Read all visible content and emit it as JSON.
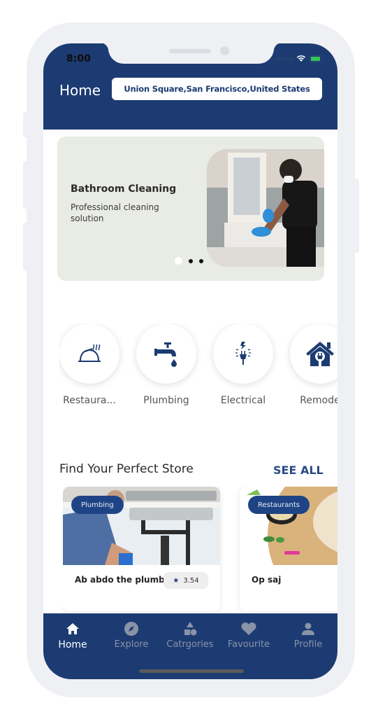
{
  "status_bar": {
    "time": "8:00"
  },
  "header": {
    "title": "Home",
    "location": "Union Square,San Francisco,United States"
  },
  "banner": {
    "title": "Bathroom Cleaning",
    "subtitle": "Professional cleaning solution",
    "slides_total": 3,
    "active_slide": 1
  },
  "categories": [
    {
      "label": "Restaura...",
      "icon": "restaurant-cloche-icon"
    },
    {
      "label": "Plumbing",
      "icon": "faucet-icon"
    },
    {
      "label": "Electrical",
      "icon": "plug-icon"
    },
    {
      "label": "Remode",
      "icon": "house-plug-icon"
    }
  ],
  "stores_section": {
    "title": "Find Your Perfect Store",
    "see_all": "SEE ALL"
  },
  "stores": [
    {
      "tag": "Plumbing",
      "name": "Ab abdo the plumber",
      "rating": "3.54"
    },
    {
      "tag": "Restaurants",
      "name": "Op saj"
    }
  ],
  "tabbar": {
    "items": [
      {
        "label": "Home",
        "icon": "home-icon",
        "active": true
      },
      {
        "label": "Explore",
        "icon": "compass-icon",
        "active": false
      },
      {
        "label": "Catrgories",
        "icon": "shapes-icon",
        "active": false
      },
      {
        "label": "Favourite",
        "icon": "heart-icon",
        "active": false
      },
      {
        "label": "Profile",
        "icon": "person-icon",
        "active": false
      }
    ]
  },
  "colors": {
    "primary": "#1c3b72",
    "frame": "#eff0f4",
    "banner_bg": "#e9ebe5",
    "tab_inactive": "#8a93a8"
  }
}
